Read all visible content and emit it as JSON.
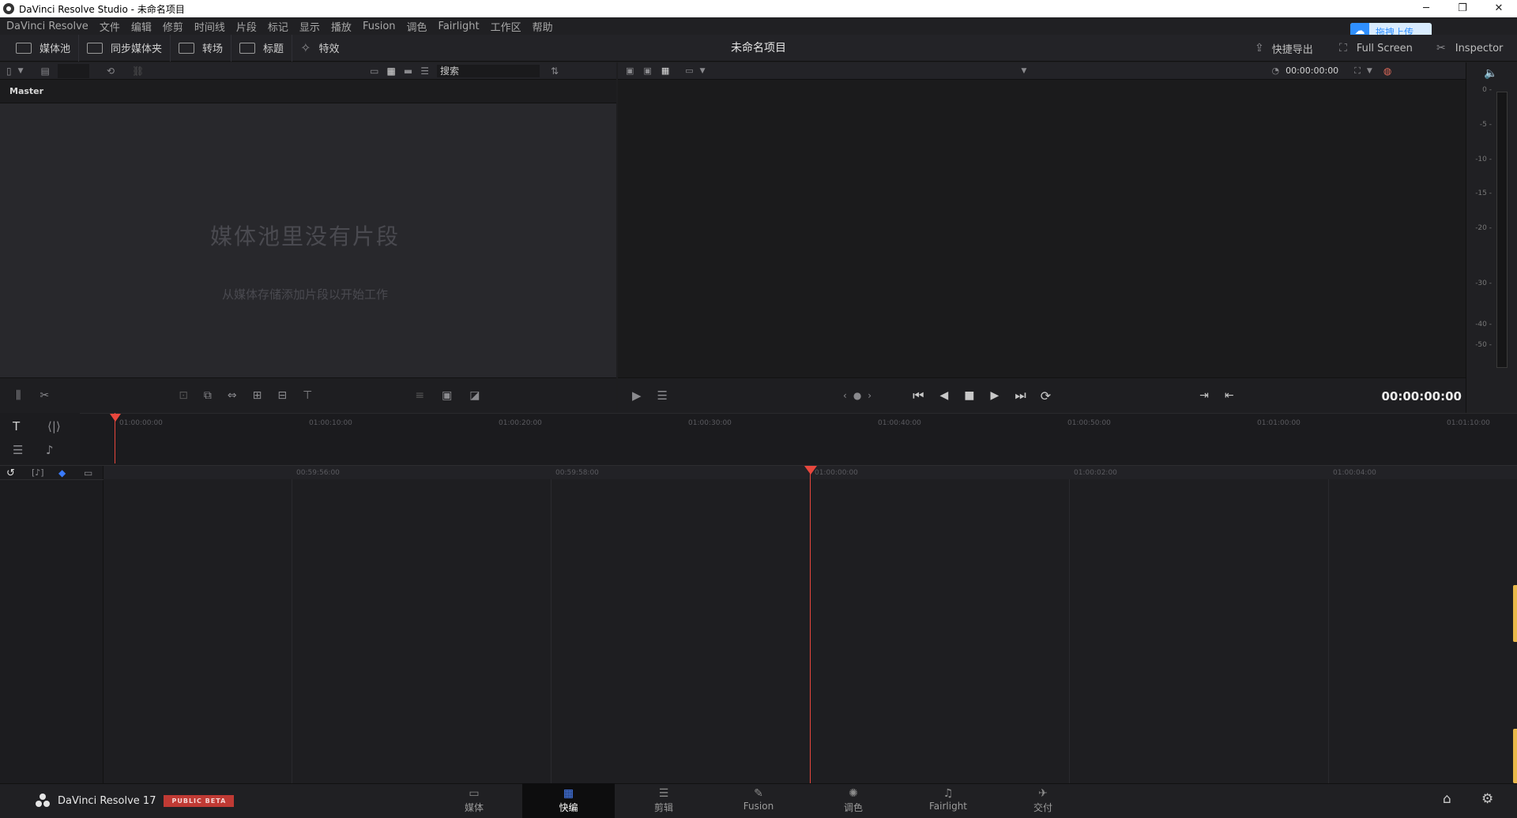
{
  "window": {
    "title": "DaVinci Resolve Studio - 未命名项目",
    "controls": [
      "─",
      "❐",
      "✕"
    ]
  },
  "menu": [
    "DaVinci Resolve",
    "文件",
    "编辑",
    "修剪",
    "时间线",
    "片段",
    "标记",
    "显示",
    "播放",
    "Fusion",
    "调色",
    "Fairlight",
    "工作区",
    "帮助"
  ],
  "toolbar": {
    "media_pool": "媒体池",
    "sync_bin": "同步媒体夹",
    "transitions": "转场",
    "titles": "标题",
    "effects": "特效",
    "project_title": "未命名项目",
    "quick_export": "快捷导出",
    "full_screen": "Full Screen",
    "inspector": "Inspector",
    "upload_badge": "拖拽上传"
  },
  "media_pool": {
    "search_placeholder": "搜索",
    "bin_name": "Master",
    "empty_title": "媒体池里没有片段",
    "empty_subtitle": "从媒体存储添加片段以开始工作"
  },
  "viewer": {
    "timecode_top": "00:00:00:00",
    "timecode_main": "00:00:00:00"
  },
  "audio_meter": {
    "labels": [
      "0 -",
      "-5 -",
      "-10 -",
      "-15 -",
      "-20 -",
      "-30 -",
      "-40 -",
      "-50 -"
    ]
  },
  "timeline": {
    "upper_ruler": [
      "01:00:00:00",
      "01:00:10:00",
      "01:00:20:00",
      "01:00:30:00",
      "01:00:40:00",
      "01:00:50:00",
      "01:01:00:00",
      "01:01:10:00"
    ],
    "lower_ruler": [
      "00:59:56:00",
      "00:59:58:00",
      "01:00:00:00",
      "01:00:02:00",
      "01:00:04:00"
    ]
  },
  "brand": {
    "name": "DaVinci Resolve 17",
    "badge": "PUBLIC BETA"
  },
  "pages": [
    {
      "label": "媒体",
      "icon": "▭"
    },
    {
      "label": "快编",
      "icon": "▦"
    },
    {
      "label": "剪辑",
      "icon": "☰"
    },
    {
      "label": "Fusion",
      "icon": "✎"
    },
    {
      "label": "调色",
      "icon": "✺"
    },
    {
      "label": "Fairlight",
      "icon": "♫"
    },
    {
      "label": "交付",
      "icon": "✈"
    }
  ],
  "active_page": "快编",
  "colors": {
    "accent_blue": "#4a83ff",
    "playhead": "#e8473d",
    "beta_badge": "#c03a34",
    "upload_blue": "#2f8fff"
  }
}
